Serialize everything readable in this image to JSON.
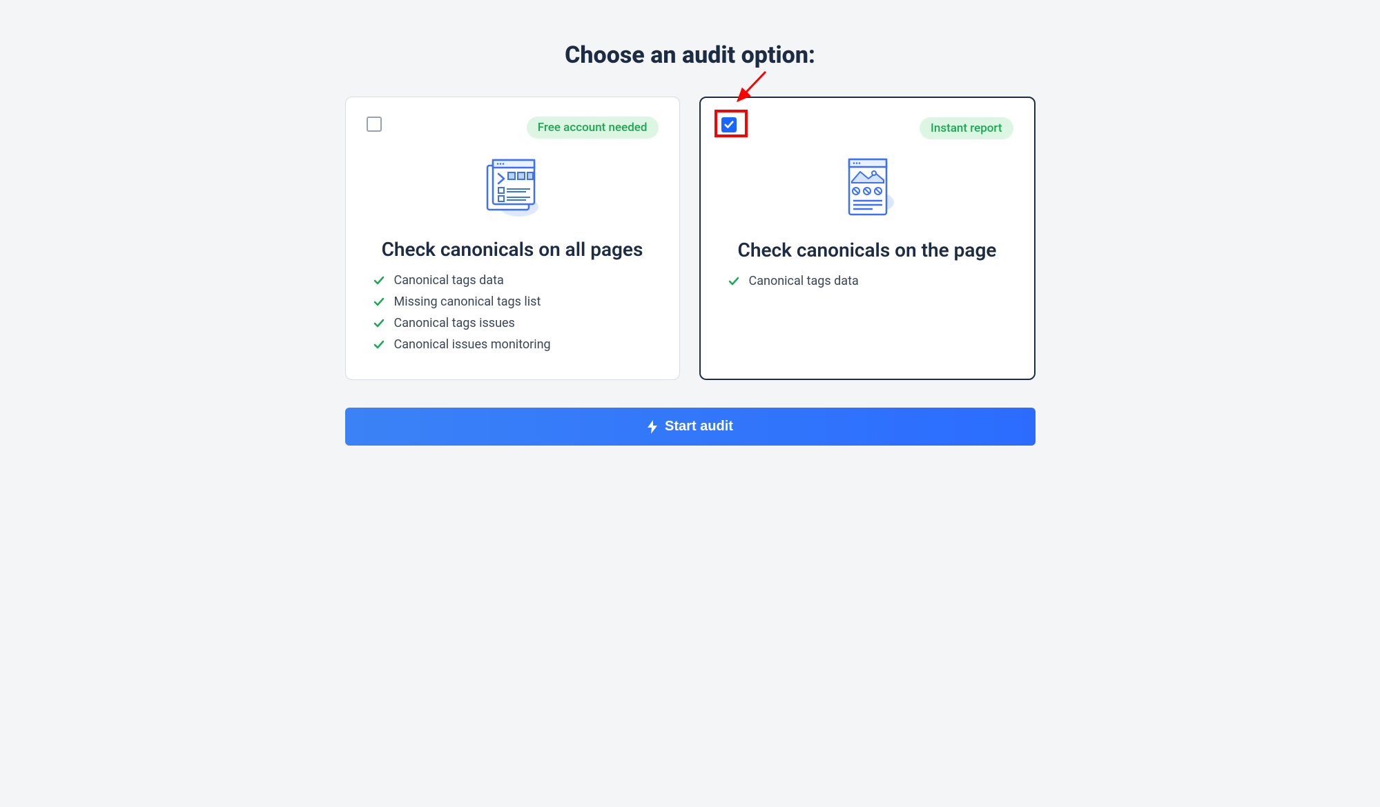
{
  "heading": "Choose an audit option:",
  "cards": [
    {
      "selected": false,
      "badge": "Free account needed",
      "title": "Check canonicals on all pages",
      "features": [
        "Canonical tags data",
        "Missing canonical tags list",
        "Canonical tags issues",
        "Canonical issues monitoring"
      ]
    },
    {
      "selected": true,
      "badge": "Instant report",
      "title": "Check canonicals on the page",
      "features": [
        "Canonical tags data"
      ]
    }
  ],
  "start_button_label": "Start audit"
}
